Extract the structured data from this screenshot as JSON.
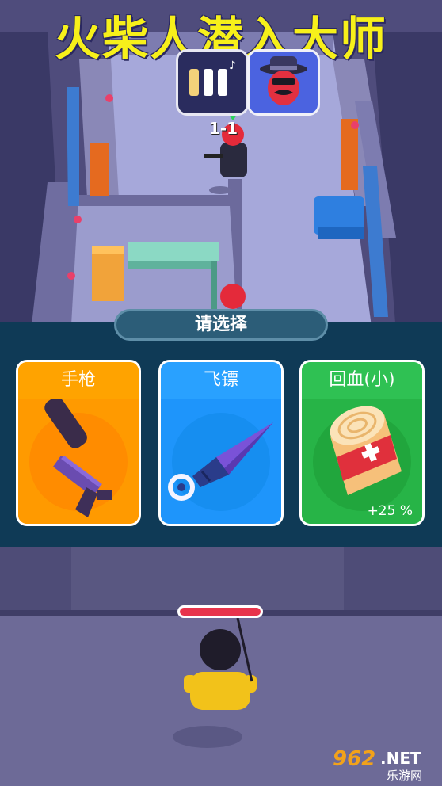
{
  "title": "火柴人潜入大师",
  "hud": {
    "pause_icon": "pause-music-icon",
    "boss_icon": "mafia-boss-icon",
    "level": "1-1"
  },
  "choose": {
    "prompt": "请选择",
    "cards": [
      {
        "label": "手枪",
        "icon": "pistol-icon",
        "color": "#ffa300"
      },
      {
        "label": "飞镖",
        "icon": "kunai-dart-icon",
        "color": "#29a1ff"
      },
      {
        "label": "回血(小)",
        "icon": "bandage-roll-icon",
        "color": "#2fc153",
        "bonus": "+25 %"
      }
    ]
  },
  "player": {
    "health_fraction": 1.0,
    "health_color": "#e8344c"
  },
  "watermark": {
    "number": "962",
    "domain": ".NET",
    "subtitle": "乐游网"
  }
}
